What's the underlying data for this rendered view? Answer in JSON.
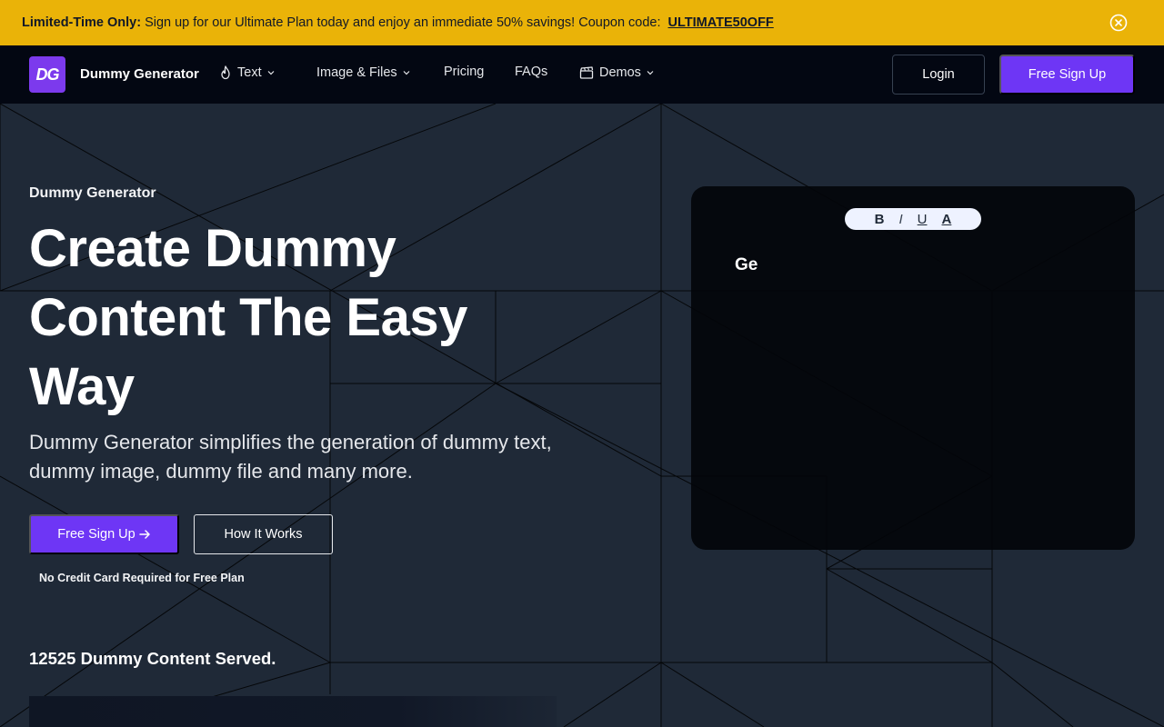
{
  "promo": {
    "lead": "Limited-Time Only:",
    "message": "Sign up for our Ultimate Plan today and enjoy an immediate 50% savings! Coupon code:",
    "coupon": "ULTIMATE50OFF",
    "close_icon": "close-circle-icon"
  },
  "nav": {
    "logo_text": "DG",
    "brand": "Dummy Generator",
    "items": [
      {
        "label": "Text",
        "icon": "flame-icon",
        "dropdown": true
      },
      {
        "label": "Image & Files",
        "dropdown": true
      },
      {
        "label": "Pricing"
      },
      {
        "label": "FAQs"
      },
      {
        "label": "Demos",
        "icon": "clapperboard-icon",
        "dropdown": true
      }
    ],
    "login": "Login",
    "signup": "Free Sign Up"
  },
  "hero": {
    "eyebrow": "Dummy Generator",
    "headline": "Create Dummy Content The Easy Way",
    "subtitle": "Dummy Generator simplifies the generation of dummy text, dummy image, dummy file and many more.",
    "primary_button": "Free Sign Up",
    "secondary_button": "How It Works",
    "note": "No Credit Card Required for Free Plan",
    "served": "12525 Dummy Content Served."
  },
  "editor": {
    "toolbar": [
      "B",
      "I",
      "U",
      "A"
    ],
    "text": "Ge"
  },
  "colors": {
    "banner": "#eab308",
    "nav_bg": "#030712",
    "hero_bg": "#1f2937",
    "accent": "#6e36f5"
  }
}
